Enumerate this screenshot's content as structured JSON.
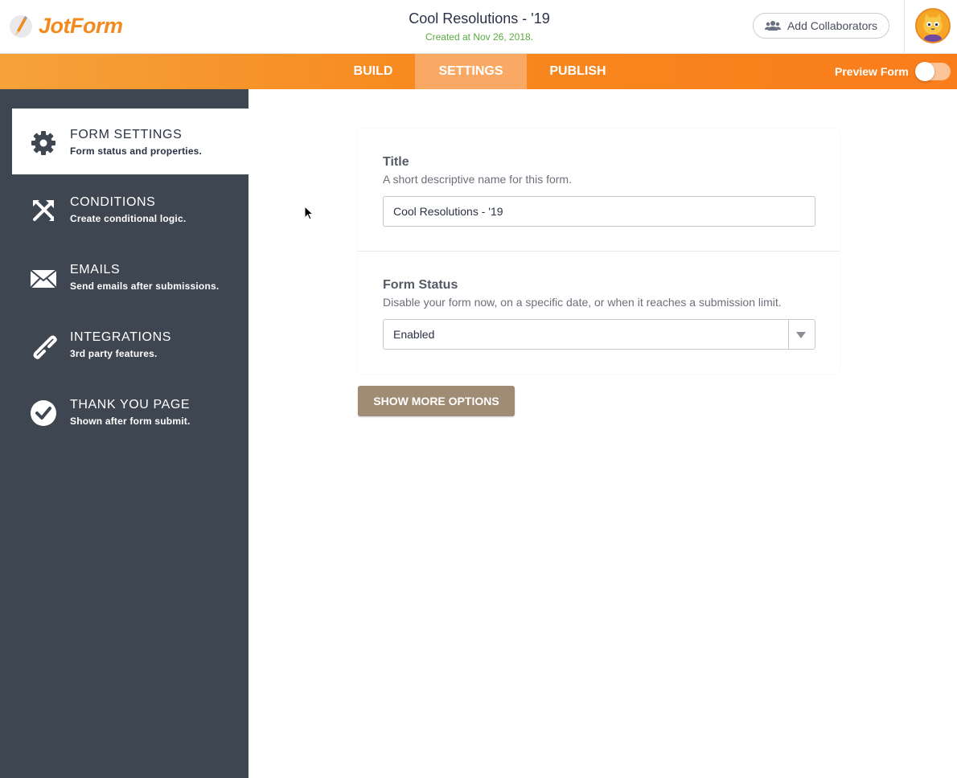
{
  "brand": {
    "name": "JotForm",
    "accent_color": "#f28b1f"
  },
  "header": {
    "form_title": "Cool Resolutions - '19",
    "created": "Created at Nov 26, 2018.",
    "collab_button": "Add Collaborators",
    "avatar_icon": "cat-avatar-icon"
  },
  "nav": {
    "tabs": [
      {
        "label": "BUILD",
        "active": false
      },
      {
        "label": "SETTINGS",
        "active": true
      },
      {
        "label": "PUBLISH",
        "active": false
      }
    ],
    "preview_label": "Preview Form",
    "preview_enabled": false
  },
  "sidebar": {
    "items": [
      {
        "title": "FORM SETTINGS",
        "subtitle": "Form status and properties.",
        "icon": "gear-icon",
        "active": true
      },
      {
        "title": "CONDITIONS",
        "subtitle": "Create conditional logic.",
        "icon": "conditions-icon",
        "active": false
      },
      {
        "title": "EMAILS",
        "subtitle": "Send emails after submissions.",
        "icon": "envelope-icon",
        "active": false
      },
      {
        "title": "INTEGRATIONS",
        "subtitle": "3rd party features.",
        "icon": "link-icon",
        "active": false
      },
      {
        "title": "THANK YOU PAGE",
        "subtitle": "Shown after form submit.",
        "icon": "check-circle-icon",
        "active": false
      }
    ]
  },
  "settings": {
    "title_label": "Title",
    "title_desc": "A short descriptive name for this form.",
    "title_value": "Cool Resolutions - '19",
    "status_label": "Form Status",
    "status_desc": "Disable your form now, on a specific date, or when it reaches a submission limit.",
    "status_value": "Enabled",
    "more_button": "SHOW MORE OPTIONS"
  }
}
